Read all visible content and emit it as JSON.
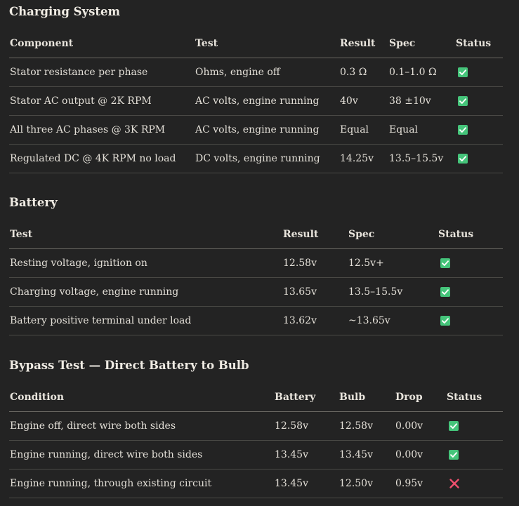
{
  "charging": {
    "title": "Charging System",
    "headers": [
      "Component",
      "Test",
      "Result",
      "Spec",
      "Status"
    ],
    "rows": [
      {
        "component": "Stator resistance per phase",
        "test": "Ohms, engine off",
        "result": "0.3 Ω",
        "spec": "0.1–1.0 Ω",
        "status": "pass"
      },
      {
        "component": "Stator AC output @ 2K RPM",
        "test": "AC volts, engine running",
        "result": "40v",
        "spec": "38 ±10v",
        "status": "pass"
      },
      {
        "component": "All three AC phases @ 3K RPM",
        "test": "AC volts, engine running",
        "result": "Equal",
        "spec": "Equal",
        "status": "pass"
      },
      {
        "component": "Regulated DC @ 4K RPM no load",
        "test": "DC volts, engine running",
        "result": "14.25v",
        "spec": "13.5–15.5v",
        "status": "pass"
      }
    ]
  },
  "battery": {
    "title": "Battery",
    "headers": [
      "Test",
      "Result",
      "Spec",
      "Status"
    ],
    "rows": [
      {
        "test": "Resting voltage, ignition on",
        "result": "12.58v",
        "spec": "12.5v+",
        "status": "pass"
      },
      {
        "test": "Charging voltage, engine running",
        "result": "13.65v",
        "spec": "13.5–15.5v",
        "status": "pass"
      },
      {
        "test": "Battery positive terminal under load",
        "result": "13.62v",
        "spec": "~13.65v",
        "status": "pass"
      }
    ]
  },
  "bypass": {
    "title": "Bypass Test — Direct Battery to Bulb",
    "headers": [
      "Condition",
      "Battery",
      "Bulb",
      "Drop",
      "Status"
    ],
    "rows": [
      {
        "condition": "Engine off, direct wire both sides",
        "battery": "12.58v",
        "bulb": "12.58v",
        "drop": "0.00v",
        "status": "pass"
      },
      {
        "condition": "Engine running, direct wire both sides",
        "battery": "13.45v",
        "bulb": "13.45v",
        "drop": "0.00v",
        "status": "pass"
      },
      {
        "condition": "Engine running, through existing circuit",
        "battery": "13.45v",
        "bulb": "12.50v",
        "drop": "0.95v",
        "status": "fail"
      }
    ]
  },
  "icons": {
    "pass": "check-mark-icon",
    "fail": "cross-mark-icon",
    "pass_color": "#45c47a",
    "fail_color": "#f0506e"
  }
}
